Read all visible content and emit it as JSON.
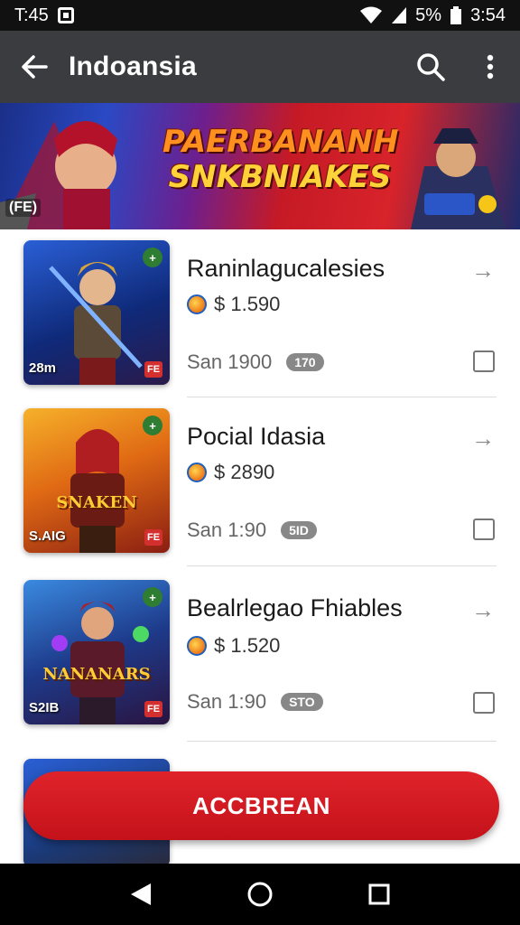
{
  "status_bar": {
    "time": "T:45",
    "battery": "5%",
    "clock": "3:54"
  },
  "app_bar": {
    "title": "Indoansia"
  },
  "banner": {
    "line1": "PAERBANANH",
    "line2": "SNKBNIAKES",
    "tag": "(FE)"
  },
  "items": [
    {
      "title": "Raninlagucalesies",
      "price": "$ 1.590",
      "meta": "San 1900",
      "pill": "170",
      "thumb_corner": "28m",
      "thumb_badge": "FE",
      "thumb_art": ""
    },
    {
      "title": "Pocial Idasia",
      "price": "$ 2890",
      "meta": "San 1:90",
      "pill": "5ID",
      "thumb_corner": "S.AIG",
      "thumb_badge": "FE",
      "thumb_art": "SNAKEN"
    },
    {
      "title": "Bealrlegao Fhiables",
      "price": "$ 1.520",
      "meta": "San 1:90",
      "pill": "STO",
      "thumb_corner": "S2IB",
      "thumb_badge": "FE",
      "thumb_art": "NANANARS"
    }
  ],
  "cta": {
    "label": "ACCBREAN"
  },
  "colors": {
    "accent": "#d81f26",
    "app_bar": "#3a3c40"
  }
}
